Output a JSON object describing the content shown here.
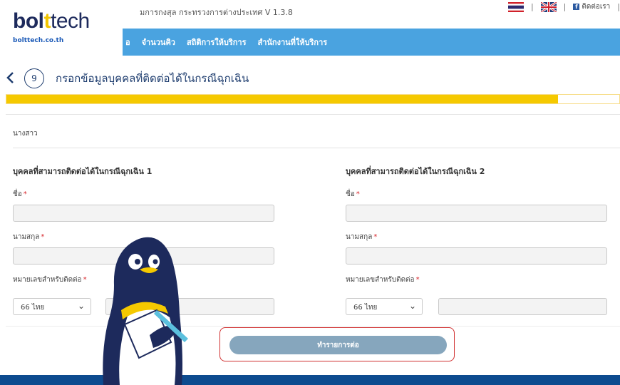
{
  "header": {
    "subtitle": "มการกงสุล กระทรวงการต่างประเทศ V 1.3.8",
    "contact_label": "ติดต่อเรา",
    "separator": "|"
  },
  "logo": {
    "part1": "bol",
    "part2": "t",
    "part3": "tech",
    "url_text": "bolttech.co.th"
  },
  "nav": {
    "items": [
      "อ",
      "จำนวนคิว",
      "สถิติการให้บริการ",
      "สำนักงานที่ให้บริการ"
    ]
  },
  "step": {
    "number": "9",
    "title": "กรอกข้อมูลบุคคลที่ติดต่อได้ในกรณีฉุกเฉิน",
    "progress": 0.9
  },
  "form": {
    "prefix_value": "นางสาว",
    "required_mark": "*",
    "contact1": {
      "title": "บุคคลที่สามารถติดต่อได้ในกรณีฉุกเฉิน 1",
      "first_name_label": "ชื่อ",
      "last_name_label": "นามสกุล",
      "phone_label": "หมายเลขสำหรับติดต่อ",
      "country_code": "66 ไทย"
    },
    "contact2": {
      "title": "บุคคลที่สามารถติดต่อได้ในกรณีฉุกเฉิน 2",
      "first_name_label": "ชื่อ",
      "last_name_label": "นามสกุล",
      "phone_label": "หมายเลขสำหรับติดต่อ",
      "country_code": "66 ไทย"
    },
    "submit_label": "ทำรายการต่อ"
  },
  "colors": {
    "nav_blue": "#4aa3e0",
    "progress_yellow": "#f5c900",
    "brand_navy": "#1d2a5c",
    "footer_blue": "#0d4b8f"
  }
}
